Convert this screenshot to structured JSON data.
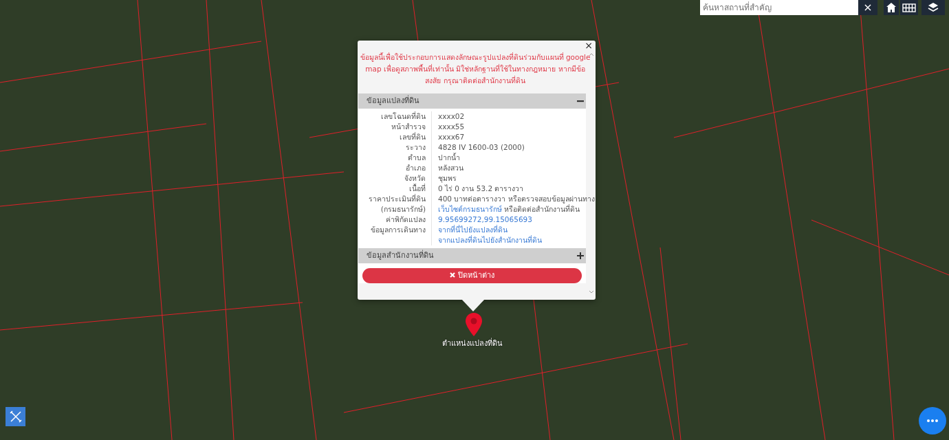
{
  "search": {
    "placeholder": "ค้นหาสถานที่สำคัญ",
    "clear": "×"
  },
  "popup": {
    "close": "×",
    "notice": "ข้อมูลนี้เพื่อใช้ประกอบการแสดงลักษณะรูปแปลงที่ดินร่วมกับแผนที่ google map เพื่อดูสภาพพื้นที่เท่านั้น มิใช่หลักฐานที่ใช้ในทางกฎหมาย หากมีข้อสงสัย กรุณาติดต่อสำนักงานที่ดิน",
    "sections": [
      {
        "title": "ข้อมูลแปลงที่ดิน",
        "expanded": true,
        "rows": [
          {
            "label": "เลขโฉนดที่ดิน",
            "lines": [
              [
                {
                  "kind": "text",
                  "text": "xxxx02"
                }
              ]
            ]
          },
          {
            "label": "หน้าสำรวจ",
            "lines": [
              [
                {
                  "kind": "text",
                  "text": "xxxx55"
                }
              ]
            ]
          },
          {
            "label": "เลขที่ดิน",
            "lines": [
              [
                {
                  "kind": "text",
                  "text": "xxxx67"
                }
              ]
            ]
          },
          {
            "label": "ระวาง",
            "lines": [
              [
                {
                  "kind": "text",
                  "text": "4828 IV 1600-03 (2000)"
                }
              ]
            ]
          },
          {
            "label": "ตำบล",
            "lines": [
              [
                {
                  "kind": "text",
                  "text": "ปากน้ำ"
                }
              ]
            ]
          },
          {
            "label": "อำเภอ",
            "lines": [
              [
                {
                  "kind": "text",
                  "text": "หลังสวน"
                }
              ]
            ]
          },
          {
            "label": "จังหวัด",
            "lines": [
              [
                {
                  "kind": "text",
                  "text": "ชุมพร"
                }
              ]
            ]
          },
          {
            "label": "เนื้อที่",
            "lines": [
              [
                {
                  "kind": "text",
                  "text": "0 ไร่ 0 งาน 53.2 ตารางวา"
                }
              ]
            ]
          },
          {
            "label": "ราคาประเมินที่ดิน",
            "lines": [
              [
                {
                  "kind": "text",
                  "text": "400 บาทต่อตารางวา หรือตรวจสอบข้อมูลผ่านทาง"
                }
              ]
            ]
          },
          {
            "label": "(กรมธนารักษ์)",
            "lines": [
              [
                {
                  "kind": "link",
                  "text": "เว็บไซต์กรมธนารักษ์"
                },
                {
                  "kind": "text",
                  "text": "หรือติดต่อสำนักงานที่ดิน"
                }
              ]
            ]
          },
          {
            "label": "ค่าพิกัดแปลง",
            "lines": [
              [
                {
                  "kind": "link",
                  "text": "9.95699272,99.15065693"
                }
              ]
            ]
          },
          {
            "label": "ข้อมูลการเดินทาง",
            "lines": [
              [
                {
                  "kind": "link",
                  "text": "จากที่นี่ไปยังแปลงที่ดิน"
                }
              ],
              [
                {
                  "kind": "link",
                  "text": "จากแปลงที่ดินไปยังสำนักงานที่ดิน"
                }
              ]
            ]
          }
        ]
      },
      {
        "title": "ข้อมูลสำนักงานที่ดิน",
        "expanded": false
      }
    ],
    "close_button": "ปิดหน้าต่าง"
  },
  "marker": {
    "label": "ตำแหน่งแปลงที่ดิน"
  }
}
